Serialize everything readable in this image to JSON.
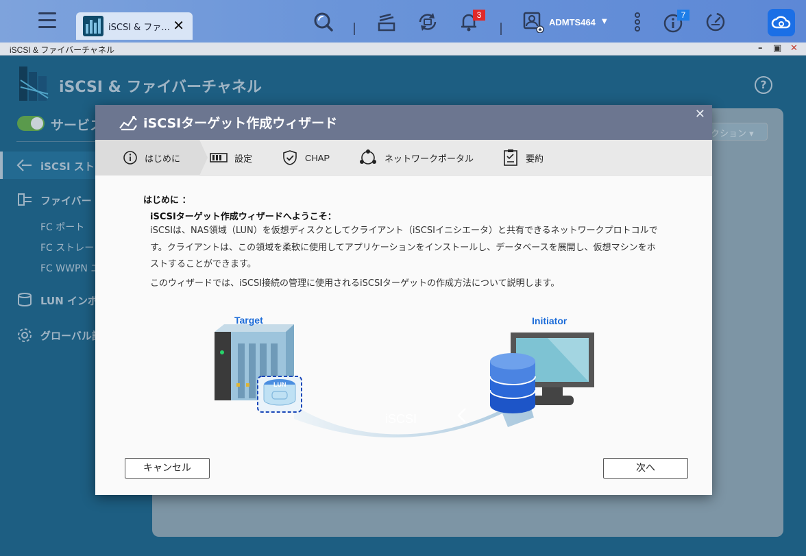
{
  "taskbar": {
    "tab_label": "iSCSI & ファ...",
    "notification_count": "3",
    "username": "ADMTS464",
    "info_count": "7"
  },
  "window": {
    "title": "iSCSI & ファイバーチャネル"
  },
  "app": {
    "title": "iSCSI & ファイバーチャネル",
    "service_label": "サービス",
    "dropdown_ghost": "クション",
    "sidebar": {
      "iscsi_storage": "iSCSI スト",
      "fibre": "ファイバー",
      "fc_port": "FC ポート",
      "fc_storage": "FC ストレー",
      "fc_wwpn": "FC WWPN エ",
      "lun_import": "LUN インポ",
      "global": "グローバル設"
    }
  },
  "wizard": {
    "title": "iSCSIターゲット作成ウィザード",
    "steps": [
      "はじめに",
      "設定",
      "CHAP",
      "ネットワークポータル",
      "要約"
    ],
    "intro_heading": "はじめに ：",
    "welcome": "iSCSIターゲット作成ウィザードへようこそ：",
    "paragraph1": "iSCSIは、NAS領域（LUN）を仮想ディスクとしてクライアント（iSCSIイニシエータ）と共有できるネットワークプロトコルです。クライアントは、この領域を柔軟に使用してアプリケーションをインストールし、データベースを展開し、仮想マシンをホストすることができます。",
    "paragraph2": "このウィザードでは、iSCSI接続の管理に使用されるiSCSIターゲットの作成方法について説明します。",
    "illustration": {
      "target_label": "Target",
      "initiator_label": "Initiator",
      "lun_label": "LUN",
      "protocol_label": "iSCSI"
    },
    "buttons": {
      "cancel": "キャンセル",
      "next": "次へ"
    }
  },
  "colors": {
    "taskbar": "#6b95d9",
    "dialog_header": "#6c7690",
    "accent_blue": "#1b6bd8",
    "app_background": "#1d5e82"
  }
}
